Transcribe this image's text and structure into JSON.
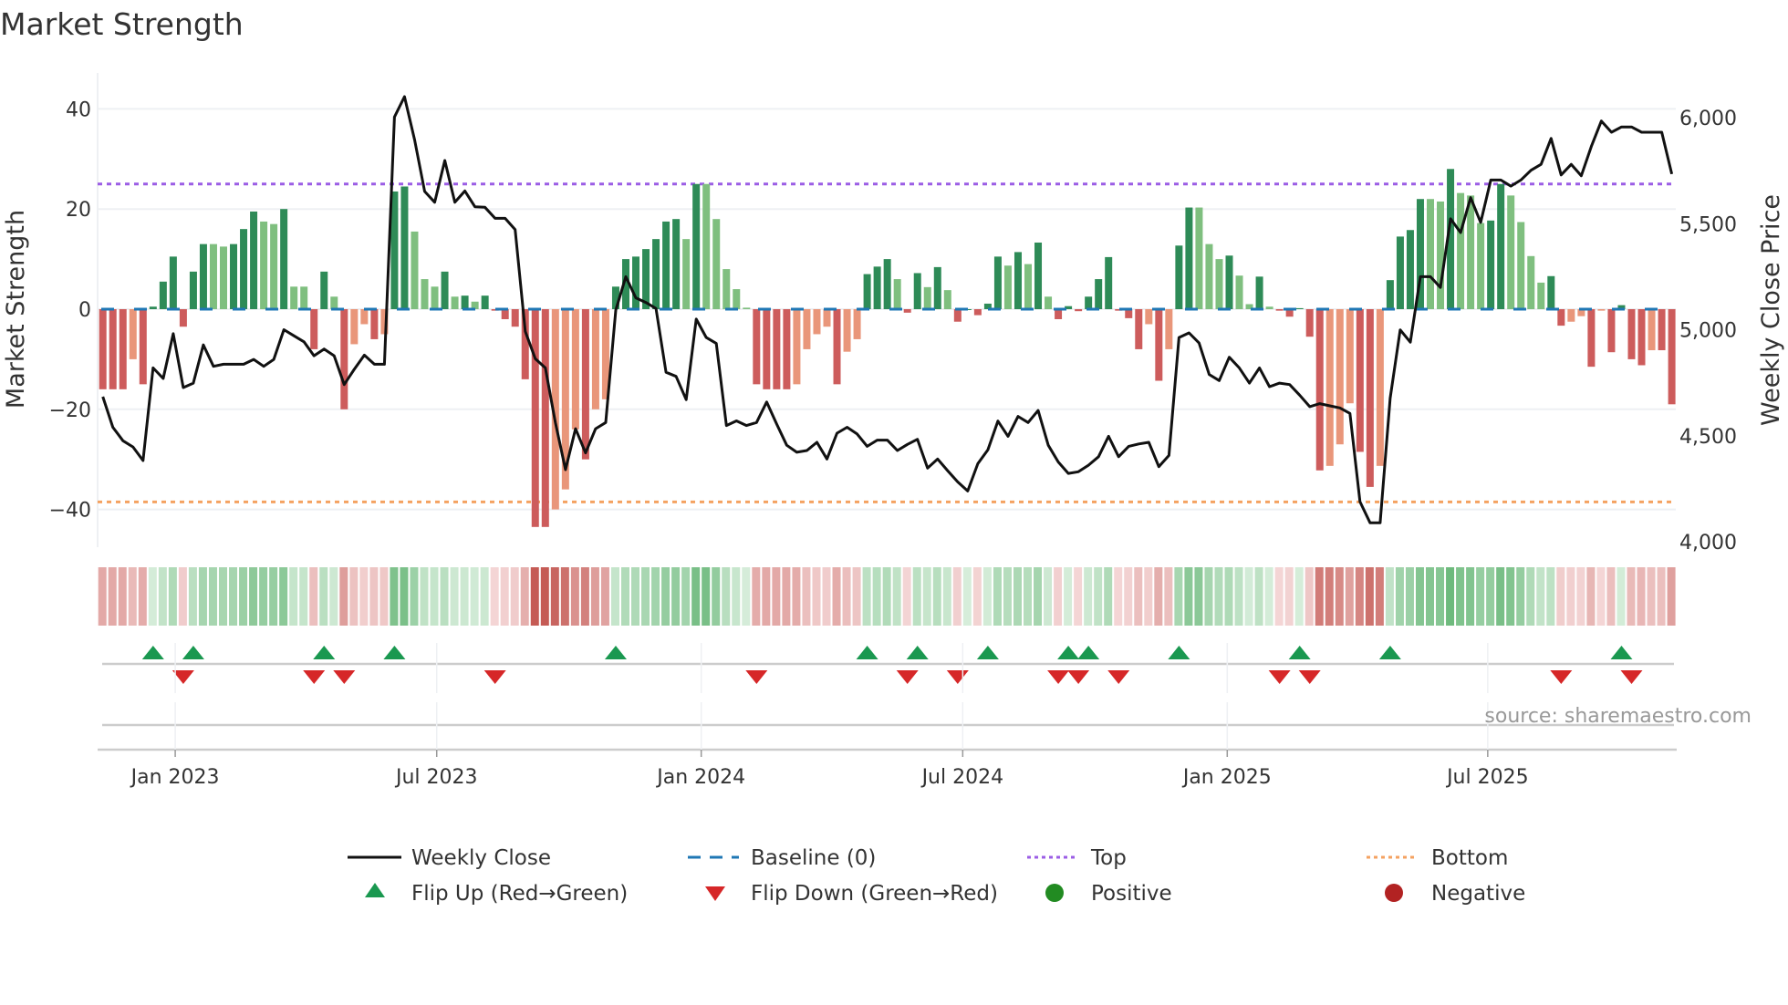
{
  "chart_data": {
    "type": "bar",
    "title": "Market Strength",
    "ylabel": "Market Strength",
    "y2label": "Weekly Close Price",
    "ylim": [
      -47,
      46
    ],
    "y2lim": [
      3980,
      6110
    ],
    "yticks": [
      {
        "v": 40,
        "label": "40"
      },
      {
        "v": 20,
        "label": "20"
      },
      {
        "v": 0,
        "label": "0"
      },
      {
        "v": -20,
        "label": "−20"
      },
      {
        "v": -40,
        "label": "−40"
      }
    ],
    "y2ticks": [
      {
        "v": 6000,
        "label": "6,000"
      },
      {
        "v": 5500,
        "label": "5,500"
      },
      {
        "v": 5000,
        "label": "5,000"
      },
      {
        "v": 4500,
        "label": "4,500"
      },
      {
        "v": 4000,
        "label": "4,000"
      }
    ],
    "xticks": [
      {
        "week": 7.2,
        "label": "Jan 2023"
      },
      {
        "week": 33.2,
        "label": "Jul 2023"
      },
      {
        "week": 59.5,
        "label": "Jan 2024"
      },
      {
        "week": 85.5,
        "label": "Jul 2024"
      },
      {
        "week": 111.8,
        "label": "Jan 2025"
      },
      {
        "week": 137.7,
        "label": "Jul 2025"
      }
    ],
    "top_level": 25,
    "bottom_level": -38.5,
    "baseline": 0,
    "strength": [
      -16,
      -16,
      -16,
      -10,
      -15,
      0.5,
      5.5,
      10.5,
      -3.5,
      7.5,
      13,
      13,
      12.5,
      13,
      16,
      19.5,
      17.5,
      17,
      20,
      4.5,
      4.5,
      -8,
      7.5,
      2.5,
      -20,
      -7,
      -3,
      -6,
      -5,
      23.5,
      24.5,
      15.5,
      6,
      4.5,
      7.5,
      2.5,
      2.7,
      1.5,
      2.7,
      -0.3,
      -2,
      -3.5,
      -14,
      -43.5,
      -43.5,
      -40,
      -36,
      -24,
      -30,
      -20,
      -18,
      4.5,
      10,
      10.5,
      12,
      14,
      17.5,
      18,
      14,
      25,
      25,
      18,
      8,
      4,
      0.3,
      -15,
      -16,
      -16,
      -16,
      -15,
      -8,
      -5,
      -3.5,
      -15,
      -8.5,
      -6,
      7,
      8.5,
      10,
      6,
      -0.7,
      7.2,
      4.4,
      8.4,
      3.8,
      -2.5,
      0,
      -1.2,
      1.1,
      10.5,
      8.7,
      11.4,
      9,
      13.3,
      2.5,
      -2,
      0.6,
      -0.4,
      2.5,
      6,
      10.4,
      -0.3,
      -1.8,
      -8,
      -3,
      -14.3,
      -8,
      12.7,
      20.3,
      20.3,
      13,
      10,
      10.7,
      6.7,
      1,
      6.5,
      0.5,
      -0.3,
      -1.5,
      0.2,
      -5.5,
      -32.2,
      -31.3,
      -27,
      -18.8,
      -28.5,
      -35.5,
      -31.3,
      5.8,
      14.5,
      15.8,
      22,
      22,
      21.5,
      28,
      23.2,
      22.7,
      17.2,
      17.7,
      25,
      22.7,
      17.4,
      10.6,
      5.3,
      6.6,
      -3.3,
      -2.5,
      -1.4,
      -11.5,
      -0.3,
      -8.6,
      0.8,
      -10,
      -11.2,
      -8.2,
      -8.2,
      -19
    ],
    "weekly_close": [
      4684,
      4540,
      4476,
      4447,
      4383,
      4820,
      4770,
      4981,
      4727,
      4748,
      4928,
      4827,
      4837,
      4837,
      4837,
      4860,
      4827,
      4860,
      5000,
      4971,
      4943,
      4877,
      4909,
      4877,
      4741,
      4813,
      4880,
      4837,
      4837,
      6003,
      6099,
      5895,
      5652,
      5601,
      5798,
      5601,
      5654,
      5580,
      5577,
      5525,
      5525,
      5472,
      4992,
      4863,
      4820,
      4562,
      4340,
      4533,
      4419,
      4533,
      4562,
      5092,
      5250,
      5150,
      5128,
      5100,
      4799,
      4780,
      4670,
      5050,
      4963,
      4935,
      4548,
      4570,
      4548,
      4562,
      4659,
      4555,
      4455,
      4422,
      4430,
      4469,
      4390,
      4512,
      4540,
      4508,
      4450,
      4479,
      4479,
      4430,
      4459,
      4483,
      4347,
      4390,
      4335,
      4282,
      4239,
      4368,
      4433,
      4569,
      4497,
      4591,
      4562,
      4619,
      4455,
      4376,
      4322,
      4330,
      4361,
      4401,
      4497,
      4401,
      4450,
      4461,
      4469,
      4354,
      4407,
      4963,
      4985,
      4937,
      4789,
      4760,
      4870,
      4820,
      4748,
      4820,
      4731,
      4748,
      4741,
      4691,
      4637,
      4651,
      4641,
      4631,
      4605,
      4189,
      4089,
      4089,
      4677,
      4999,
      4941,
      5250,
      5250,
      5199,
      5523,
      5458,
      5623,
      5506,
      5706,
      5706,
      5677,
      5706,
      5752,
      5780,
      5902,
      5730,
      5780,
      5726,
      5864,
      5984,
      5931,
      5956,
      5956,
      5931,
      5931,
      5931,
      5734
    ],
    "flip_up_weeks": [
      5,
      9,
      22,
      29,
      51,
      76,
      81,
      88,
      96,
      98,
      107,
      119,
      128,
      151
    ],
    "flip_down_weeks": [
      8,
      21,
      24,
      39,
      65,
      80,
      85,
      95,
      97,
      101,
      117,
      120,
      145,
      152
    ],
    "legend_position": "bottom"
  },
  "colors": {
    "green_dark": "#2e8b57",
    "green_light": "#7fbf7f",
    "red_dark": "#cd5c5c",
    "red_light": "#e9967a",
    "baseline": "#1f77b4",
    "top": "#9b5de5",
    "bottom": "#f4a261",
    "flip_up": "#1a9850",
    "flip_down": "#d62728",
    "positive": "#228b22",
    "negative": "#b22222",
    "line": "#111111"
  },
  "legend": {
    "weekly_close": "Weekly Close",
    "baseline": "Baseline (0)",
    "top": "Top",
    "bottom": "Bottom",
    "flip_up": "Flip Up (Red→Green)",
    "flip_down": "Flip Down (Green→Red)",
    "positive": "Positive",
    "negative": "Negative"
  },
  "source": "source: sharemaestro.com"
}
